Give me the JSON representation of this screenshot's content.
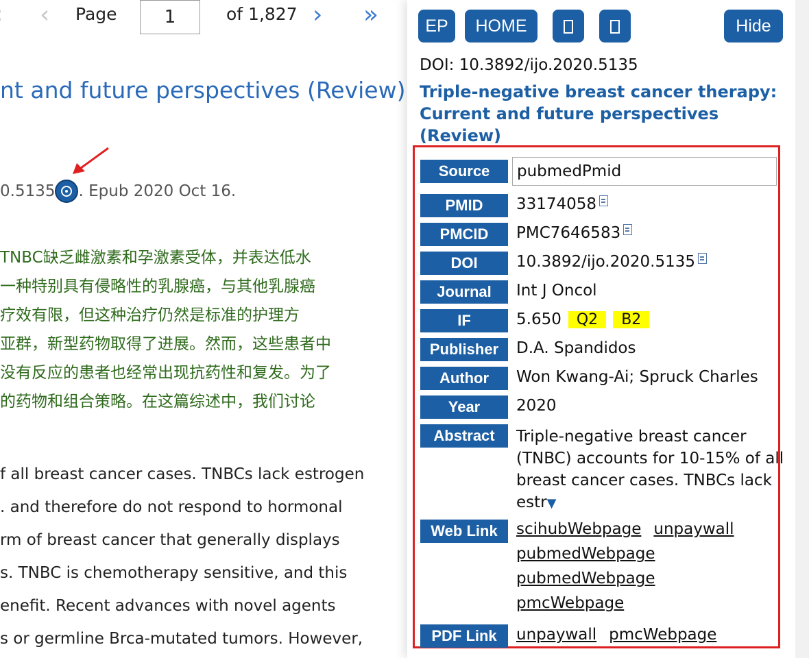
{
  "viewer": {
    "page_label": "Page",
    "page_number": "1",
    "page_total": "of 1,827",
    "article_title_fragment": "nt and future perspectives (Review).",
    "citation_pre": "0.5135",
    "citation_post": ". Epub 2020 Oct 16.",
    "chinese_lines": [
      "TNBC缺乏雌激素和孕激素受体，并表达低水",
      "一种特别具有侵略性的乳腺癌，与其他乳腺癌",
      "疗效有限，但这种治疗仍然是标准的护理方",
      "亚群，新型药物取得了进展。然而，这些患者中",
      "没有反应的患者也经常出现抗药性和复发。为了",
      "的药物和组合策略。在这篇综述中，我们讨论"
    ],
    "english_lines": [
      "f all breast cancer cases. TNBCs lack estrogen",
      ". and therefore do not respond to hormonal",
      "rm of breast cancer that generally displays",
      "s. TNBC is chemotherapy sensitive, and this",
      "enefit. Recent advances with novel agents",
      "s or germline Brca-mutated tumors. However,"
    ]
  },
  "panel": {
    "toolbar": {
      "logo_label": "EP",
      "home_label": "HOME",
      "hide_label": "Hide"
    },
    "doi_line": "DOI: 10.3892/ijo.2020.5135",
    "title": "Triple-negative breast cancer therapy: Current and future perspectives (Review)",
    "fields": {
      "source_label": "Source",
      "source_value": "pubmedPmid",
      "pmid_label": "PMID",
      "pmid_value": "33174058",
      "pmcid_label": "PMCID",
      "pmcid_value": "PMC7646583",
      "doi_label": "DOI",
      "doi_value": "10.3892/ijo.2020.5135",
      "journal_label": "Journal",
      "journal_value": "Int J Oncol",
      "if_label": "IF",
      "if_value": "5.650",
      "quartile": "Q2",
      "grade": "B2",
      "publisher_label": "Publisher",
      "publisher_value": "D.A. Spandidos",
      "author_label": "Author",
      "author_value": "Won Kwang-Ai; Spruck Charles",
      "year_label": "Year",
      "year_value": "2020",
      "abstract_label": "Abstract",
      "abstract_value": "Triple-negative breast cancer (TNBC) accounts for 10-15% of all breast cancer cases. TNBCs lack estr",
      "expand_glyph": "▼",
      "weblink_label": "Web Link",
      "weblinks": [
        "scihubWebpage",
        "unpaywall",
        "pubmedWebpage",
        "pubmedWebpage",
        "pmcWebpage"
      ],
      "pdflink_label": "PDF Link",
      "pdflinks": [
        "unpaywall",
        "pmcWebpage"
      ]
    },
    "colors": {
      "button_blue": "#1d5fa4",
      "highlight_red": "#dd2020",
      "tag_yellow": "#ffff00"
    }
  }
}
